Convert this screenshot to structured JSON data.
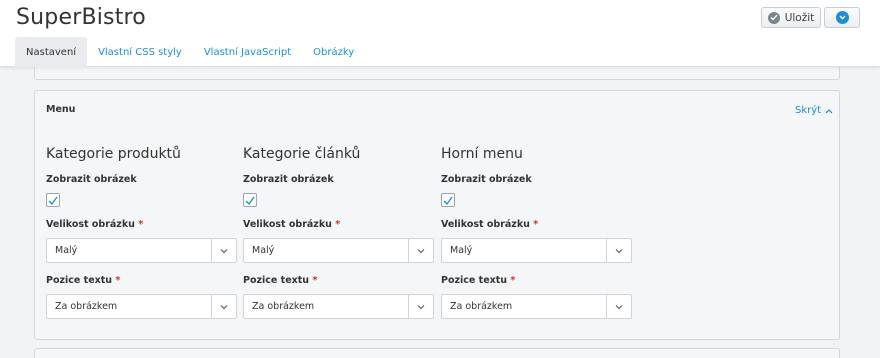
{
  "header": {
    "title": "SuperBistro",
    "save_label": "Uložit"
  },
  "tabs": [
    {
      "label": "Nastavení",
      "active": true
    },
    {
      "label": "Vlastní CSS styly",
      "active": false
    },
    {
      "label": "Vlastní JavaScript",
      "active": false
    },
    {
      "label": "Obrázky",
      "active": false
    }
  ],
  "menu_panel": {
    "title": "Menu",
    "collapse_label": "Skrýt",
    "columns": [
      {
        "heading": "Kategorie produktů",
        "show_image_label": "Zobrazit obrázek",
        "show_image_checked": true,
        "image_size_label": "Velikost obrázku",
        "image_size_value": "Malý",
        "text_position_label": "Pozice textu",
        "text_position_value": "Za obrázkem"
      },
      {
        "heading": "Kategorie článků",
        "show_image_label": "Zobrazit obrázek",
        "show_image_checked": true,
        "image_size_label": "Velikost obrázku",
        "image_size_value": "Malý",
        "text_position_label": "Pozice textu",
        "text_position_value": "Za obrázkem"
      },
      {
        "heading": "Horní menu",
        "show_image_label": "Zobrazit obrázek",
        "show_image_checked": true,
        "image_size_label": "Velikost obrázku",
        "image_size_value": "Malý",
        "text_position_label": "Pozice textu",
        "text_position_value": "Za obrázkem"
      }
    ]
  },
  "required_marker": "*",
  "colors": {
    "accent": "#1a8fd6",
    "required": "#c9302c",
    "panel_bg": "#f5f6f7",
    "page_bg": "#f2f3f5"
  },
  "icons": {
    "save": "check-circle-icon",
    "more": "chevron-down-circle-icon",
    "collapse": "chevron-up-icon",
    "select_arrow": "chevron-down-icon",
    "checkbox": "checkmark-icon"
  }
}
